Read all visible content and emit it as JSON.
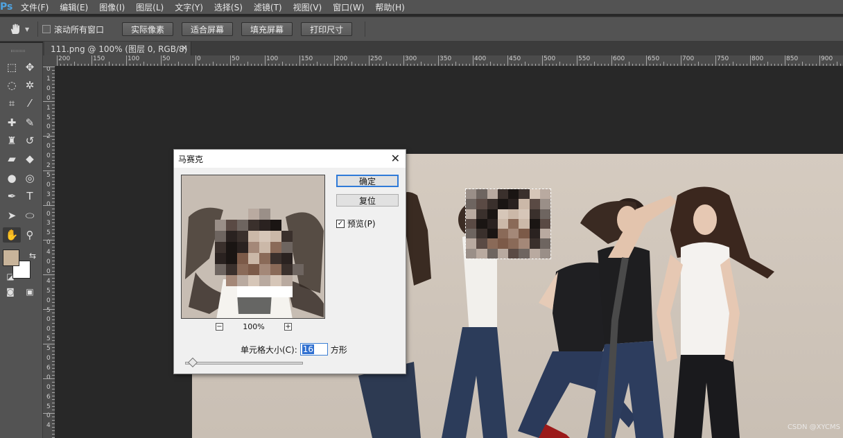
{
  "app": {
    "logo": "Ps"
  },
  "menu": [
    "文件(F)",
    "编辑(E)",
    "图像(I)",
    "图层(L)",
    "文字(Y)",
    "选择(S)",
    "滤镜(T)",
    "视图(V)",
    "窗口(W)",
    "帮助(H)"
  ],
  "options": {
    "scroll_all_label": "滚动所有窗口",
    "buttons": [
      "实际像素",
      "适合屏幕",
      "填充屏幕",
      "打印尺寸"
    ]
  },
  "document_tab": {
    "title": "111.png @ 100% (图层 0, RGB/8)",
    "close": "×"
  },
  "ruler_h_labels": [
    "200",
    "150",
    "100",
    "50",
    "0",
    "50",
    "100",
    "150",
    "200",
    "250",
    "300",
    "350",
    "400",
    "450",
    "500",
    "550",
    "600",
    "650",
    "700",
    "750",
    "800",
    "850",
    "900"
  ],
  "ruler_v_labels": [
    "0",
    "1",
    "0",
    "0",
    "1",
    "5",
    "0",
    "2",
    "0",
    "0",
    "2",
    "5",
    "0",
    "3",
    "0",
    "0",
    "3",
    "5",
    "0",
    "4",
    "0",
    "0",
    "4",
    "5",
    "0",
    "5",
    "0",
    "0",
    "5",
    "5",
    "0",
    "6",
    "0",
    "0",
    "6",
    "5",
    "0",
    "4"
  ],
  "tools": [
    {
      "name": "marquee-icon",
      "glyph": "⬚"
    },
    {
      "name": "move-icon",
      "glyph": "✥"
    },
    {
      "name": "lasso-icon",
      "glyph": "◌"
    },
    {
      "name": "magic-wand-icon",
      "glyph": "✲"
    },
    {
      "name": "crop-icon",
      "glyph": "⌗"
    },
    {
      "name": "eyedropper-icon",
      "glyph": "⁄"
    },
    {
      "name": "healing-brush-icon",
      "glyph": "✚"
    },
    {
      "name": "brush-icon",
      "glyph": "✎"
    },
    {
      "name": "clone-stamp-icon",
      "glyph": "♜"
    },
    {
      "name": "history-brush-icon",
      "glyph": "↺"
    },
    {
      "name": "eraser-icon",
      "glyph": "▰"
    },
    {
      "name": "paint-bucket-icon",
      "glyph": "◆"
    },
    {
      "name": "blur-icon",
      "glyph": "●"
    },
    {
      "name": "dodge-icon",
      "glyph": "◎"
    },
    {
      "name": "pen-icon",
      "glyph": "✒"
    },
    {
      "name": "type-icon",
      "glyph": "T"
    },
    {
      "name": "path-selection-icon",
      "glyph": "➤"
    },
    {
      "name": "ellipse-icon",
      "glyph": "⬭"
    },
    {
      "name": "hand-icon",
      "glyph": "✋"
    },
    {
      "name": "zoom-icon",
      "glyph": "⚲"
    }
  ],
  "colors": {
    "foreground": "#c8b49a",
    "background": "#ffffff",
    "accent": "#2f7ad8"
  },
  "dialog": {
    "title": "马赛克",
    "close": "✕",
    "ok_label": "确定",
    "reset_label": "复位",
    "preview_label": "预览(P)",
    "preview_checked": "✓",
    "zoom_out": "−",
    "zoom_in": "+",
    "zoom_level": "100%",
    "cell_size_label": "单元格大小(C):",
    "cell_size_value": "16",
    "cell_size_unit": "方形"
  },
  "watermark": "CSDN @XYCMS"
}
